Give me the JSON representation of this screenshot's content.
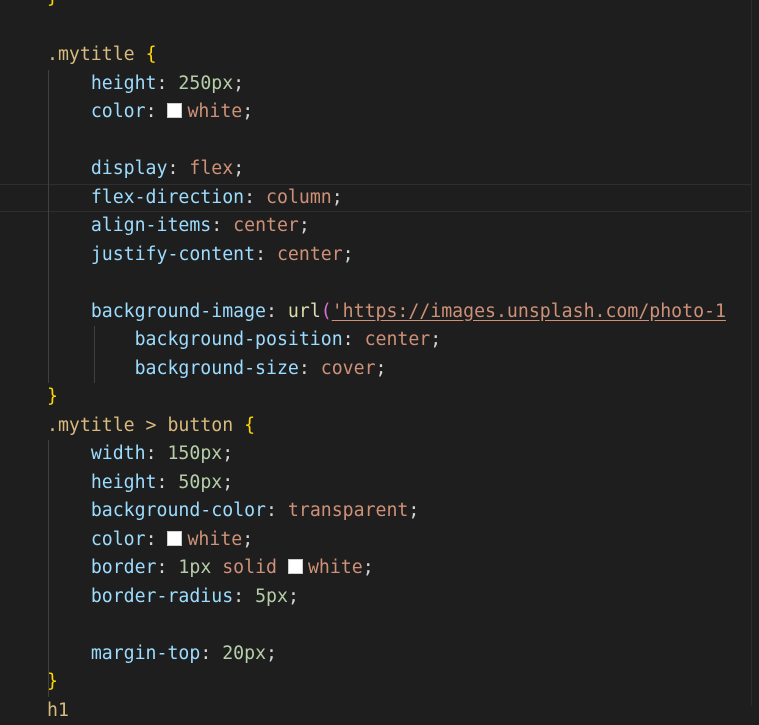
{
  "editor": {
    "indent_unit": "    ",
    "lines": [
      {
        "indent": 0,
        "tokens": [
          {
            "t": "}",
            "c": "brace"
          }
        ]
      },
      {
        "indent": 0,
        "tokens": []
      },
      {
        "indent": 0,
        "tokens": [
          {
            "t": ".mytitle ",
            "c": "sel"
          },
          {
            "t": "{",
            "c": "brace"
          }
        ]
      },
      {
        "indent": 1,
        "tokens": [
          {
            "t": "height",
            "c": "prop"
          },
          {
            "t": ": ",
            "c": "punc"
          },
          {
            "t": "250px",
            "c": "num"
          },
          {
            "t": ";",
            "c": "punc"
          }
        ]
      },
      {
        "indent": 1,
        "tokens": [
          {
            "t": "color",
            "c": "prop"
          },
          {
            "t": ": ",
            "c": "punc"
          },
          {
            "swatch": "#ffffff"
          },
          {
            "t": "white",
            "c": "val"
          },
          {
            "t": ";",
            "c": "punc"
          }
        ]
      },
      {
        "indent": 0,
        "tokens": []
      },
      {
        "indent": 1,
        "tokens": [
          {
            "t": "display",
            "c": "prop"
          },
          {
            "t": ": ",
            "c": "punc"
          },
          {
            "t": "flex",
            "c": "val"
          },
          {
            "t": ";",
            "c": "punc"
          }
        ]
      },
      {
        "indent": 1,
        "current": true,
        "tokens": [
          {
            "t": "flex-direction",
            "c": "prop"
          },
          {
            "t": ": ",
            "c": "punc"
          },
          {
            "t": "column",
            "c": "val"
          },
          {
            "t": ";",
            "c": "punc"
          }
        ]
      },
      {
        "indent": 1,
        "tokens": [
          {
            "t": "align-items",
            "c": "prop"
          },
          {
            "t": ": ",
            "c": "punc"
          },
          {
            "t": "center",
            "c": "val"
          },
          {
            "t": ";",
            "c": "punc"
          }
        ]
      },
      {
        "indent": 1,
        "tokens": [
          {
            "t": "justify-content",
            "c": "prop"
          },
          {
            "t": ": ",
            "c": "punc"
          },
          {
            "t": "center",
            "c": "val"
          },
          {
            "t": ";",
            "c": "punc"
          }
        ]
      },
      {
        "indent": 0,
        "tokens": []
      },
      {
        "indent": 1,
        "tokens": [
          {
            "t": "background-image",
            "c": "prop"
          },
          {
            "t": ": ",
            "c": "punc"
          },
          {
            "t": "url",
            "c": "fn"
          },
          {
            "t": "(",
            "c": "paren"
          },
          {
            "t": "'https://images.unsplash.com/photo-1",
            "c": "url"
          }
        ]
      },
      {
        "indent": 2,
        "tokens": [
          {
            "t": "background-position",
            "c": "prop"
          },
          {
            "t": ": ",
            "c": "punc"
          },
          {
            "t": "center",
            "c": "val"
          },
          {
            "t": ";",
            "c": "punc"
          }
        ]
      },
      {
        "indent": 2,
        "tokens": [
          {
            "t": "background-size",
            "c": "prop"
          },
          {
            "t": ": ",
            "c": "punc"
          },
          {
            "t": "cover",
            "c": "val"
          },
          {
            "t": ";",
            "c": "punc"
          }
        ]
      },
      {
        "indent": 0,
        "tokens": [
          {
            "t": "}",
            "c": "brace"
          }
        ]
      },
      {
        "indent": 0,
        "tokens": [
          {
            "t": ".mytitle > button ",
            "c": "sel"
          },
          {
            "t": "{",
            "c": "brace"
          }
        ]
      },
      {
        "indent": 1,
        "tokens": [
          {
            "t": "width",
            "c": "prop"
          },
          {
            "t": ": ",
            "c": "punc"
          },
          {
            "t": "150px",
            "c": "num"
          },
          {
            "t": ";",
            "c": "punc"
          }
        ]
      },
      {
        "indent": 1,
        "tokens": [
          {
            "t": "height",
            "c": "prop"
          },
          {
            "t": ": ",
            "c": "punc"
          },
          {
            "t": "50px",
            "c": "num"
          },
          {
            "t": ";",
            "c": "punc"
          }
        ]
      },
      {
        "indent": 1,
        "tokens": [
          {
            "t": "background-color",
            "c": "prop"
          },
          {
            "t": ": ",
            "c": "punc"
          },
          {
            "t": "transparent",
            "c": "val"
          },
          {
            "t": ";",
            "c": "punc"
          }
        ]
      },
      {
        "indent": 1,
        "tokens": [
          {
            "t": "color",
            "c": "prop"
          },
          {
            "t": ": ",
            "c": "punc"
          },
          {
            "swatch": "#ffffff"
          },
          {
            "t": "white",
            "c": "val"
          },
          {
            "t": ";",
            "c": "punc"
          }
        ]
      },
      {
        "indent": 1,
        "tokens": [
          {
            "t": "border",
            "c": "prop"
          },
          {
            "t": ": ",
            "c": "punc"
          },
          {
            "t": "1px",
            "c": "num"
          },
          {
            "t": " ",
            "c": "punc"
          },
          {
            "t": "solid",
            "c": "val"
          },
          {
            "t": " ",
            "c": "punc"
          },
          {
            "swatch": "#ffffff"
          },
          {
            "t": "white",
            "c": "val"
          },
          {
            "t": ";",
            "c": "punc"
          }
        ]
      },
      {
        "indent": 1,
        "tokens": [
          {
            "t": "border-radius",
            "c": "prop"
          },
          {
            "t": ": ",
            "c": "punc"
          },
          {
            "t": "5px",
            "c": "num"
          },
          {
            "t": ";",
            "c": "punc"
          }
        ]
      },
      {
        "indent": 0,
        "tokens": []
      },
      {
        "indent": 1,
        "tokens": [
          {
            "t": "margin-top",
            "c": "prop"
          },
          {
            "t": ": ",
            "c": "punc"
          },
          {
            "t": "20px",
            "c": "num"
          },
          {
            "t": ";",
            "c": "punc"
          }
        ]
      },
      {
        "indent": 0,
        "tokens": [
          {
            "t": "}",
            "c": "brace"
          }
        ]
      },
      {
        "indent": 0,
        "tokens": [
          {
            "t": "h1",
            "c": "sel"
          }
        ]
      }
    ]
  },
  "colors": {
    "background": "#1e1e1e",
    "selector": "#d7ba7d",
    "brace": "#ffd700",
    "property": "#9cdcfe",
    "number": "#b5cea8",
    "value": "#ce9178",
    "function": "#dcdcaa",
    "paren": "#da70d6"
  }
}
